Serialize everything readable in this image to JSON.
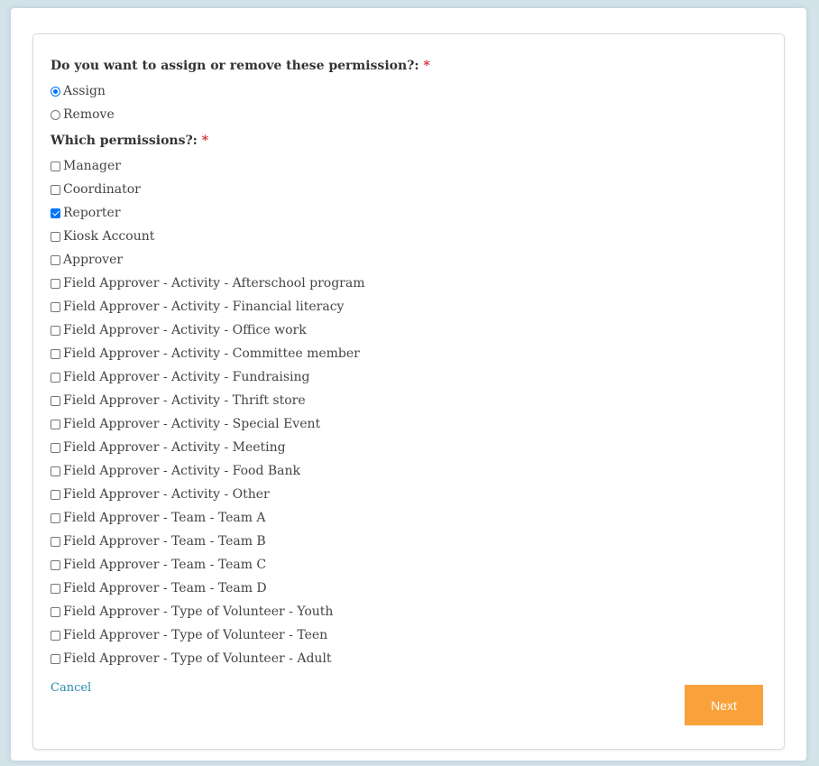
{
  "assign_question": {
    "label": "Do you want to assign or remove these permission?:",
    "required_mark": "*",
    "options": [
      {
        "label": "Assign",
        "checked": true
      },
      {
        "label": "Remove",
        "checked": false
      }
    ]
  },
  "permissions_question": {
    "label": "Which permissions?:",
    "required_mark": "*",
    "options": [
      {
        "label": "Manager",
        "checked": false
      },
      {
        "label": "Coordinator",
        "checked": false
      },
      {
        "label": "Reporter",
        "checked": true
      },
      {
        "label": "Kiosk Account",
        "checked": false
      },
      {
        "label": "Approver",
        "checked": false
      },
      {
        "label": "Field Approver - Activity - Afterschool program",
        "checked": false
      },
      {
        "label": "Field Approver - Activity - Financial literacy",
        "checked": false
      },
      {
        "label": "Field Approver - Activity - Office work",
        "checked": false
      },
      {
        "label": "Field Approver - Activity - Committee member",
        "checked": false
      },
      {
        "label": "Field Approver - Activity - Fundraising",
        "checked": false
      },
      {
        "label": "Field Approver - Activity - Thrift store",
        "checked": false
      },
      {
        "label": "Field Approver - Activity - Special Event",
        "checked": false
      },
      {
        "label": "Field Approver - Activity - Meeting",
        "checked": false
      },
      {
        "label": "Field Approver - Activity - Food Bank",
        "checked": false
      },
      {
        "label": "Field Approver - Activity - Other",
        "checked": false
      },
      {
        "label": "Field Approver - Team - Team A",
        "checked": false
      },
      {
        "label": "Field Approver - Team - Team B",
        "checked": false
      },
      {
        "label": "Field Approver - Team - Team C",
        "checked": false
      },
      {
        "label": "Field Approver - Team - Team D",
        "checked": false
      },
      {
        "label": "Field Approver - Type of Volunteer - Youth",
        "checked": false
      },
      {
        "label": "Field Approver - Type of Volunteer - Teen",
        "checked": false
      },
      {
        "label": "Field Approver - Type of Volunteer - Adult",
        "checked": false
      }
    ]
  },
  "footer": {
    "cancel_label": "Cancel",
    "next_label": "Next"
  },
  "colors": {
    "accent": "#f9a23b",
    "link": "#2a8aa8",
    "required": "#d9262c",
    "checked": "#0075ff"
  }
}
